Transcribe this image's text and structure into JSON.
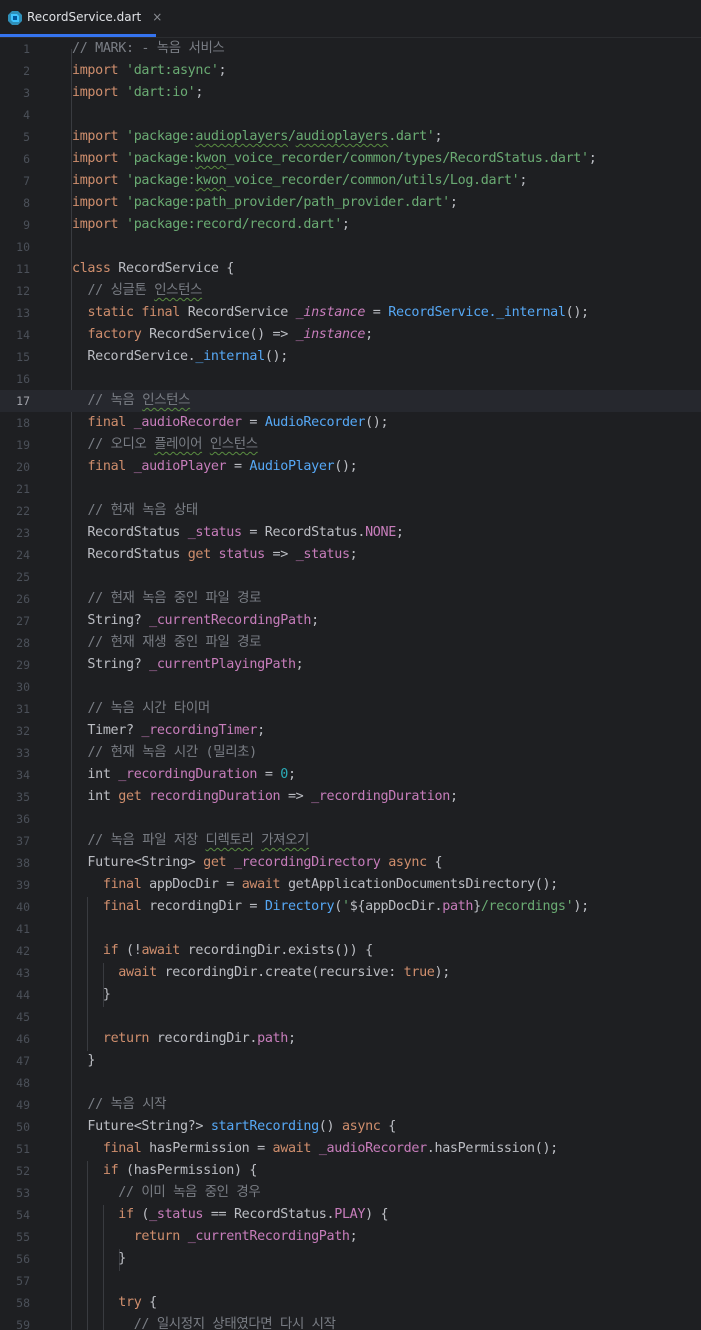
{
  "tab": {
    "file_name": "RecordService.dart",
    "close_glyph": "×",
    "icon": "dart-file-icon"
  },
  "editor": {
    "current_line": 17,
    "colors": {
      "background": "#1e1f22",
      "keyword": "#cf8e6d",
      "string": "#6aab73",
      "comment": "#7a7e85",
      "number": "#2aacb8",
      "field": "#c77dbb",
      "function": "#56a8f5",
      "plain": "#bcbec4"
    },
    "lines": [
      {
        "n": "1",
        "tokens": [
          {
            "t": "// MARK: - 녹음 서비스",
            "c": "cm"
          }
        ]
      },
      {
        "n": "2",
        "tokens": [
          {
            "t": "import ",
            "c": "kw"
          },
          {
            "t": "'dart:async'",
            "c": "str"
          },
          {
            "t": ";"
          }
        ]
      },
      {
        "n": "3",
        "tokens": [
          {
            "t": "import ",
            "c": "kw"
          },
          {
            "t": "'dart:io'",
            "c": "str"
          },
          {
            "t": ";"
          }
        ]
      },
      {
        "n": "4",
        "tokens": []
      },
      {
        "n": "5",
        "tokens": [
          {
            "t": "import ",
            "c": "kw"
          },
          {
            "t": "'package:",
            "c": "str"
          },
          {
            "t": "audioplayers",
            "c": "str sq"
          },
          {
            "t": "/",
            "c": "str"
          },
          {
            "t": "audioplayers",
            "c": "str sq"
          },
          {
            "t": ".dart'",
            "c": "str"
          },
          {
            "t": ";"
          }
        ]
      },
      {
        "n": "6",
        "tokens": [
          {
            "t": "import ",
            "c": "kw"
          },
          {
            "t": "'package:",
            "c": "str"
          },
          {
            "t": "kwon",
            "c": "str sq"
          },
          {
            "t": "_voice_recorder/common/types/RecordStatus.dart'",
            "c": "str"
          },
          {
            "t": ";"
          }
        ]
      },
      {
        "n": "7",
        "tokens": [
          {
            "t": "import ",
            "c": "kw"
          },
          {
            "t": "'package:",
            "c": "str"
          },
          {
            "t": "kwon",
            "c": "str sq"
          },
          {
            "t": "_voice_recorder/common/utils/Log.dart'",
            "c": "str"
          },
          {
            "t": ";"
          }
        ]
      },
      {
        "n": "8",
        "tokens": [
          {
            "t": "import ",
            "c": "kw"
          },
          {
            "t": "'package:path_provider/path_provider.dart'",
            "c": "str"
          },
          {
            "t": ";"
          }
        ]
      },
      {
        "n": "9",
        "tokens": [
          {
            "t": "import ",
            "c": "kw"
          },
          {
            "t": "'package:record/record.dart'",
            "c": "str"
          },
          {
            "t": ";"
          }
        ]
      },
      {
        "n": "10",
        "tokens": []
      },
      {
        "n": "11",
        "tokens": [
          {
            "t": "class ",
            "c": "kw"
          },
          {
            "t": "RecordService {"
          }
        ]
      },
      {
        "n": "12",
        "tokens": [
          {
            "t": "  "
          },
          {
            "t": "// 싱글톤 ",
            "c": "cm"
          },
          {
            "t": "인스턴스",
            "c": "cm sq"
          }
        ]
      },
      {
        "n": "13",
        "tokens": [
          {
            "t": "  "
          },
          {
            "t": "static final ",
            "c": "kw"
          },
          {
            "t": "RecordService "
          },
          {
            "t": "_instance",
            "c": "itf"
          },
          {
            "t": " = "
          },
          {
            "t": "RecordService.",
            "c": "cls"
          },
          {
            "t": "_internal",
            "c": "fn"
          },
          {
            "t": "();"
          }
        ]
      },
      {
        "n": "14",
        "tokens": [
          {
            "t": "  "
          },
          {
            "t": "factory ",
            "c": "kw"
          },
          {
            "t": "RecordService() => "
          },
          {
            "t": "_instance",
            "c": "itf"
          },
          {
            "t": ";"
          }
        ]
      },
      {
        "n": "15",
        "tokens": [
          {
            "t": "  RecordService."
          },
          {
            "t": "_internal",
            "c": "fn"
          },
          {
            "t": "();"
          }
        ]
      },
      {
        "n": "16",
        "tokens": []
      },
      {
        "n": "17",
        "tokens": [
          {
            "t": "  "
          },
          {
            "t": "// 녹음 ",
            "c": "cm"
          },
          {
            "t": "인스턴스",
            "c": "cm sq"
          }
        ]
      },
      {
        "n": "18",
        "tokens": [
          {
            "t": "  "
          },
          {
            "t": "final ",
            "c": "kw"
          },
          {
            "t": "_audioRecorder",
            "c": "fld"
          },
          {
            "t": " = "
          },
          {
            "t": "AudioRecorder",
            "c": "cls"
          },
          {
            "t": "();"
          }
        ]
      },
      {
        "n": "19",
        "tokens": [
          {
            "t": "  "
          },
          {
            "t": "// 오디오 ",
            "c": "cm"
          },
          {
            "t": "플레이어",
            "c": "cm sq"
          },
          {
            "t": " ",
            "c": "cm"
          },
          {
            "t": "인스턴스",
            "c": "cm sq"
          }
        ]
      },
      {
        "n": "20",
        "tokens": [
          {
            "t": "  "
          },
          {
            "t": "final ",
            "c": "kw"
          },
          {
            "t": "_audioPlayer",
            "c": "fld"
          },
          {
            "t": " = "
          },
          {
            "t": "AudioPlayer",
            "c": "cls"
          },
          {
            "t": "();"
          }
        ]
      },
      {
        "n": "21",
        "tokens": []
      },
      {
        "n": "22",
        "tokens": [
          {
            "t": "  "
          },
          {
            "t": "// 현재 녹음 상태",
            "c": "cm"
          }
        ]
      },
      {
        "n": "23",
        "tokens": [
          {
            "t": "  RecordStatus "
          },
          {
            "t": "_status",
            "c": "fld"
          },
          {
            "t": " = RecordStatus."
          },
          {
            "t": "NONE",
            "c": "fld"
          },
          {
            "t": ";"
          }
        ]
      },
      {
        "n": "24",
        "tokens": [
          {
            "t": "  RecordStatus "
          },
          {
            "t": "get ",
            "c": "kw"
          },
          {
            "t": "status",
            "c": "fld"
          },
          {
            "t": " => "
          },
          {
            "t": "_status",
            "c": "fld"
          },
          {
            "t": ";"
          }
        ]
      },
      {
        "n": "25",
        "tokens": []
      },
      {
        "n": "26",
        "tokens": [
          {
            "t": "  "
          },
          {
            "t": "// 현재 녹음 중인 파일 경로",
            "c": "cm"
          }
        ]
      },
      {
        "n": "27",
        "tokens": [
          {
            "t": "  String? "
          },
          {
            "t": "_currentRecordingPath",
            "c": "fld"
          },
          {
            "t": ";"
          }
        ]
      },
      {
        "n": "28",
        "tokens": [
          {
            "t": "  "
          },
          {
            "t": "// 현재 재생 중인 파일 경로",
            "c": "cm"
          }
        ]
      },
      {
        "n": "29",
        "tokens": [
          {
            "t": "  String? "
          },
          {
            "t": "_currentPlayingPath",
            "c": "fld"
          },
          {
            "t": ";"
          }
        ]
      },
      {
        "n": "30",
        "tokens": []
      },
      {
        "n": "31",
        "tokens": [
          {
            "t": "  "
          },
          {
            "t": "// 녹음 시간 타이머",
            "c": "cm"
          }
        ]
      },
      {
        "n": "32",
        "tokens": [
          {
            "t": "  Timer? "
          },
          {
            "t": "_recordingTimer",
            "c": "fld"
          },
          {
            "t": ";"
          }
        ]
      },
      {
        "n": "33",
        "tokens": [
          {
            "t": "  "
          },
          {
            "t": "// 현재 녹음 시간 (밀리초)",
            "c": "cm"
          }
        ]
      },
      {
        "n": "34",
        "tokens": [
          {
            "t": "  int "
          },
          {
            "t": "_recordingDuration",
            "c": "fld"
          },
          {
            "t": " = "
          },
          {
            "t": "0",
            "c": "num"
          },
          {
            "t": ";"
          }
        ]
      },
      {
        "n": "35",
        "tokens": [
          {
            "t": "  int "
          },
          {
            "t": "get ",
            "c": "kw"
          },
          {
            "t": "recordingDuration",
            "c": "fld"
          },
          {
            "t": " => "
          },
          {
            "t": "_recordingDuration",
            "c": "fld"
          },
          {
            "t": ";"
          }
        ]
      },
      {
        "n": "36",
        "tokens": []
      },
      {
        "n": "37",
        "tokens": [
          {
            "t": "  "
          },
          {
            "t": "// 녹음 파일 저장 ",
            "c": "cm"
          },
          {
            "t": "디렉토리",
            "c": "cm sq"
          },
          {
            "t": " ",
            "c": "cm"
          },
          {
            "t": "가져오기",
            "c": "cm sq"
          }
        ]
      },
      {
        "n": "38",
        "tokens": [
          {
            "t": "  Future<String> "
          },
          {
            "t": "get ",
            "c": "kw"
          },
          {
            "t": "_recordingDirectory",
            "c": "fld"
          },
          {
            "t": " "
          },
          {
            "t": "async",
            "c": "kw"
          },
          {
            "t": " {"
          }
        ]
      },
      {
        "n": "39",
        "tokens": [
          {
            "t": "    "
          },
          {
            "t": "final ",
            "c": "kw"
          },
          {
            "t": "appDocDir = "
          },
          {
            "t": "await ",
            "c": "kw"
          },
          {
            "t": "getApplicationDocumentsDirectory();"
          }
        ]
      },
      {
        "n": "40",
        "tokens": [
          {
            "t": "    "
          },
          {
            "t": "final ",
            "c": "kw"
          },
          {
            "t": "recordingDir = "
          },
          {
            "t": "Directory",
            "c": "cls"
          },
          {
            "t": "("
          },
          {
            "t": "'",
            "c": "str"
          },
          {
            "t": "${appDocDir."
          },
          {
            "t": "path",
            "c": "fld"
          },
          {
            "t": "}"
          },
          {
            "t": "/recordings'",
            "c": "str"
          },
          {
            "t": ");"
          }
        ]
      },
      {
        "n": "41",
        "tokens": []
      },
      {
        "n": "42",
        "tokens": [
          {
            "t": "    "
          },
          {
            "t": "if ",
            "c": "kw"
          },
          {
            "t": "(!"
          },
          {
            "t": "await ",
            "c": "kw"
          },
          {
            "t": "recordingDir.exists()) {"
          }
        ]
      },
      {
        "n": "43",
        "tokens": [
          {
            "t": "      "
          },
          {
            "t": "await ",
            "c": "kw"
          },
          {
            "t": "recordingDir.create(recursive: "
          },
          {
            "t": "true",
            "c": "kw"
          },
          {
            "t": ");"
          }
        ]
      },
      {
        "n": "44",
        "tokens": [
          {
            "t": "    }"
          }
        ]
      },
      {
        "n": "45",
        "tokens": []
      },
      {
        "n": "46",
        "tokens": [
          {
            "t": "    "
          },
          {
            "t": "return ",
            "c": "kw"
          },
          {
            "t": "recordingDir."
          },
          {
            "t": "path",
            "c": "fld"
          },
          {
            "t": ";"
          }
        ]
      },
      {
        "n": "47",
        "tokens": [
          {
            "t": "  }"
          }
        ]
      },
      {
        "n": "48",
        "tokens": []
      },
      {
        "n": "49",
        "tokens": [
          {
            "t": "  "
          },
          {
            "t": "// 녹음 시작",
            "c": "cm"
          }
        ]
      },
      {
        "n": "50",
        "tokens": [
          {
            "t": "  Future<String?> "
          },
          {
            "t": "startRecording",
            "c": "fn"
          },
          {
            "t": "() "
          },
          {
            "t": "async",
            "c": "kw"
          },
          {
            "t": " {"
          }
        ]
      },
      {
        "n": "51",
        "tokens": [
          {
            "t": "    "
          },
          {
            "t": "final ",
            "c": "kw"
          },
          {
            "t": "hasPermission = "
          },
          {
            "t": "await ",
            "c": "kw"
          },
          {
            "t": "_audioRecorder",
            "c": "fld"
          },
          {
            "t": ".hasPermission();"
          }
        ]
      },
      {
        "n": "52",
        "tokens": [
          {
            "t": "    "
          },
          {
            "t": "if ",
            "c": "kw"
          },
          {
            "t": "(hasPermission) {"
          }
        ]
      },
      {
        "n": "53",
        "tokens": [
          {
            "t": "      "
          },
          {
            "t": "// 이미 녹음 중인 경우",
            "c": "cm"
          }
        ]
      },
      {
        "n": "54",
        "tokens": [
          {
            "t": "      "
          },
          {
            "t": "if ",
            "c": "kw"
          },
          {
            "t": "("
          },
          {
            "t": "_status",
            "c": "fld"
          },
          {
            "t": " == RecordStatus."
          },
          {
            "t": "PLAY",
            "c": "fld"
          },
          {
            "t": ") {"
          }
        ]
      },
      {
        "n": "55",
        "tokens": [
          {
            "t": "        "
          },
          {
            "t": "return ",
            "c": "kw"
          },
          {
            "t": "_currentRecordingPath",
            "c": "fld"
          },
          {
            "t": ";"
          }
        ]
      },
      {
        "n": "56",
        "tokens": [
          {
            "t": "      }"
          }
        ]
      },
      {
        "n": "57",
        "tokens": []
      },
      {
        "n": "58",
        "tokens": [
          {
            "t": "      "
          },
          {
            "t": "try ",
            "c": "kw"
          },
          {
            "t": "{"
          }
        ]
      },
      {
        "n": "59",
        "tokens": [
          {
            "t": "        "
          },
          {
            "t": "// 일시정지 상태였다면 다시 시작",
            "c": "cm"
          }
        ]
      }
    ]
  }
}
